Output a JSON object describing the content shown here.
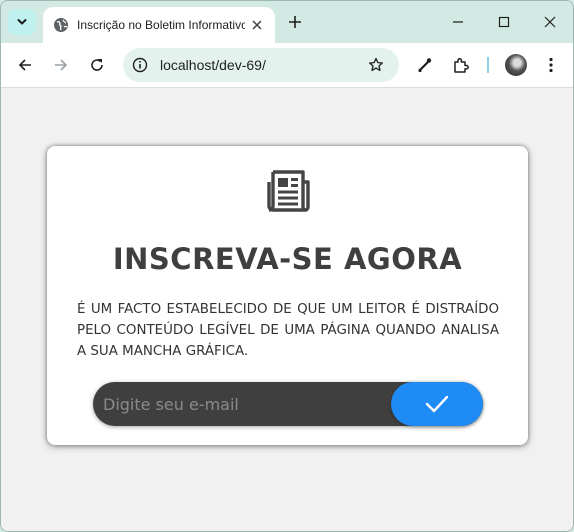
{
  "browser": {
    "tab": {
      "title": "Inscrição no Boletim Informativo"
    },
    "address_bar": {
      "url": "localhost/dev-69/"
    }
  },
  "page": {
    "headline": "INSCREVA-SE AGORA",
    "description": "É UM FACTO ESTABELECIDO DE QUE UM LEITOR É DISTRAÍDO PELO CONTEÚDO LEGÍVEL DE UMA PÁGINA QUANDO ANALISA A SUA MANCHA GRÁFICA.",
    "form": {
      "email_placeholder": "Digite seu e-mail",
      "email_value": ""
    }
  },
  "colors": {
    "accent": "#1f8bf5",
    "input_background": "#3f3f3f",
    "heading_text": "#3f3f3f",
    "chrome_frame": "#d3e9e3"
  },
  "icons": {
    "tab_search": "chevron-down-icon",
    "favicon": "globe-icon",
    "card": "newspaper-icon",
    "submit": "checkmark-icon"
  }
}
